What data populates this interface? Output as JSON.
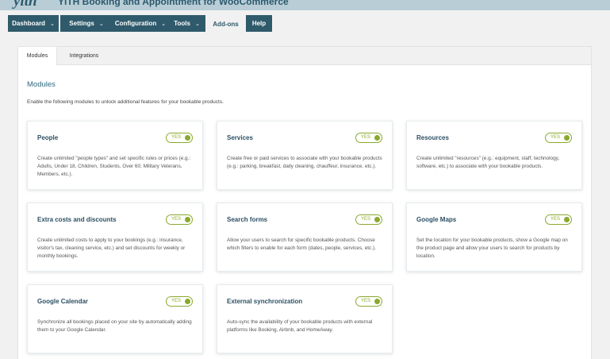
{
  "app": {
    "logo": "yith",
    "title": "YITH Booking and Appointment for WooCommerce"
  },
  "nav": [
    {
      "label": "Dashboard",
      "has_dropdown": true
    },
    {
      "label": "Settings",
      "has_dropdown": true
    },
    {
      "label": "Configuration",
      "has_dropdown": true
    },
    {
      "label": "Tools",
      "has_dropdown": true
    },
    {
      "label": "Add-ons",
      "active": true
    },
    {
      "label": "Help"
    }
  ],
  "tabs": [
    {
      "label": "Modules",
      "active": true
    },
    {
      "label": "Integrations"
    }
  ],
  "section": {
    "title": "Modules",
    "description": "Enable the following modules to unlock additional features for your bookable products."
  },
  "modules": [
    {
      "title": "People",
      "toggle": "YES",
      "description": "Create unlimited \"people types\" and set specific rules or prices (e.g.: Adults, Under 18, Children, Students, Over 60, Military Veterans, Members, etc.)."
    },
    {
      "title": "Services",
      "toggle": "YES",
      "description": "Create free or paid services to associate with your bookable products (e.g.: parking, breakfast, daily cleaning, chauffeur, insurance, etc.)."
    },
    {
      "title": "Resources",
      "toggle": "YES",
      "description": "Create unlimited \"resources\" (e.g.: equipment, staff, technology, software, etc.) to associate with your bookable products."
    },
    {
      "title": "Extra costs and discounts",
      "toggle": "YES",
      "description": "Create unlimited costs to apply to your bookings (e.g.: insurance, visitor's tax, cleaning service, etc.) and set discounts for weekly or monthly bookings."
    },
    {
      "title": "Search forms",
      "toggle": "YES",
      "description": "Allow your users to search for specific bookable products. Choose which filters to enable for each form (dates, people, services, etc.)."
    },
    {
      "title": "Google Maps",
      "toggle": "YES",
      "description": "Set the location for your bookable products, show a Google map on the product page and allow your users to search for products by location."
    },
    {
      "title": "Google Calendar",
      "toggle": "YES",
      "description": "Synchronize all bookings placed on your site by automatically adding them to your Google Calendar."
    },
    {
      "title": "External synchronization",
      "toggle": "YES",
      "description": "Auto-sync the availability of your bookable products with external platforms like Booking, Airbnb, and HomeAway."
    }
  ],
  "colors": {
    "nav_bg": "#2f5a6b",
    "toggle_on": "#8aa92e",
    "heading": "#2f6a82"
  },
  "icons": {
    "dropdown": "chevron-down-icon"
  }
}
